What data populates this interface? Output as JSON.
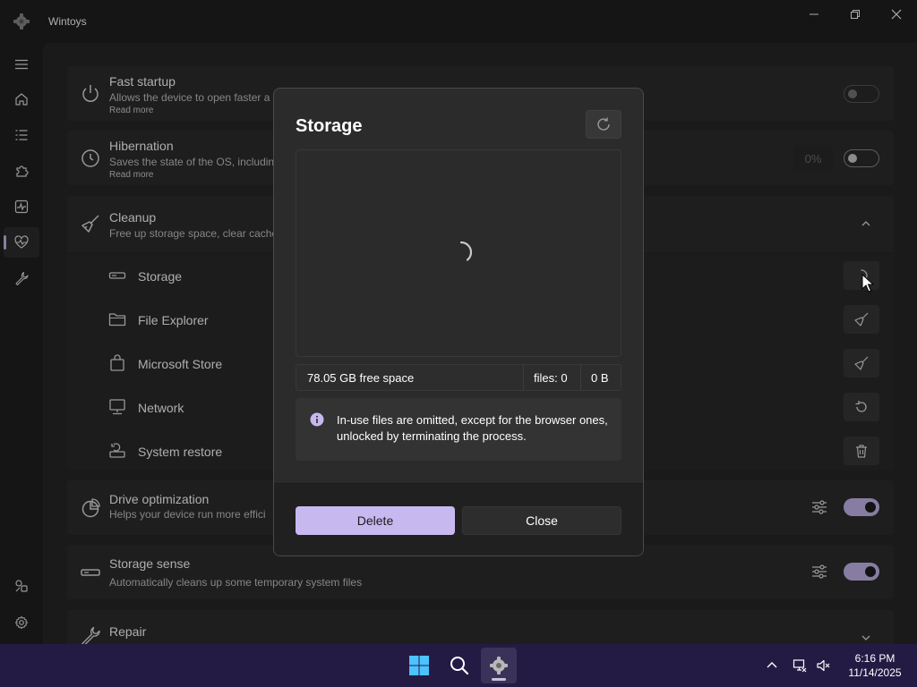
{
  "window": {
    "title": "Wintoys",
    "controls": {
      "minimize": "minimize-icon",
      "restore": "restore-icon",
      "close": "close-icon"
    }
  },
  "sidebar": {
    "items": [
      {
        "name": "menu",
        "icon": "hamburger-icon"
      },
      {
        "name": "home",
        "icon": "home-icon"
      },
      {
        "name": "apps",
        "icon": "list-icon"
      },
      {
        "name": "extensions",
        "icon": "puzzle-icon"
      },
      {
        "name": "performance",
        "icon": "pulse-icon"
      },
      {
        "name": "health",
        "icon": "heart-pulse-icon",
        "active": true
      },
      {
        "name": "tools",
        "icon": "wrench-icon"
      },
      {
        "name": "links",
        "icon": "links-icon"
      },
      {
        "name": "settings",
        "icon": "gear-icon"
      }
    ]
  },
  "cards": {
    "fast_startup": {
      "title": "Fast startup",
      "desc": "Allows the device to open faster a",
      "link": "Read more",
      "toggle": "off"
    },
    "hibernation": {
      "title": "Hibernation",
      "desc": "Saves the state of the OS, includin",
      "link": "Read more",
      "value": "0%",
      "toggle": "off"
    },
    "cleanup": {
      "title": "Cleanup",
      "desc": "Free up storage space, clear cache",
      "expanded": true,
      "items": [
        {
          "label": "Storage",
          "icon": "drive-icon",
          "action": "loading-spinner-icon"
        },
        {
          "label": "File Explorer",
          "icon": "folder-icon",
          "action": "broom-icon"
        },
        {
          "label": "Microsoft Store",
          "icon": "store-bag-icon",
          "action": "broom-icon"
        },
        {
          "label": "Network",
          "icon": "monitor-network-icon",
          "action": "reset-icon"
        },
        {
          "label": "System restore",
          "icon": "system-restore-icon",
          "action": "trash-icon"
        }
      ]
    },
    "drive_optimization": {
      "title": "Drive optimization",
      "desc": "Helps your device run more effici",
      "toggle": "on"
    },
    "storage_sense": {
      "title": "Storage sense",
      "desc": "Automatically cleans up some temporary system files",
      "toggle": "on"
    },
    "repair": {
      "title": "Repair",
      "desc": ""
    }
  },
  "dialog": {
    "title": "Storage",
    "free_space": "78.05 GB free space",
    "files": "files: 0",
    "size": "0 B",
    "info": "In-use files are omitted, except for the browser ones, unlocked by terminating the process.",
    "delete_label": "Delete",
    "close_label": "Close"
  },
  "taskbar": {
    "apps": [
      {
        "name": "start",
        "icon": "windows-logo-icon"
      },
      {
        "name": "search",
        "icon": "search-icon"
      },
      {
        "name": "wintoys",
        "icon": "wintoys-app-icon",
        "active": true
      }
    ],
    "tray": [
      "chevron-up-icon",
      "network-icon",
      "volume-muted-icon"
    ],
    "time": "6:16 PM",
    "date": "11/14/2025"
  },
  "colors": {
    "accent": "#c7b9f0",
    "taskbar": "#241b45",
    "window_bg": "#202020",
    "card_bg": "#2d2d2d"
  }
}
